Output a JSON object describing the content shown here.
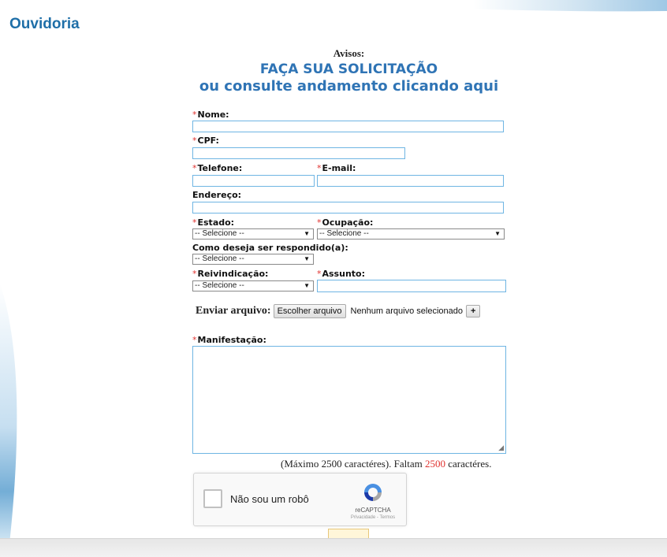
{
  "page": {
    "title": "Ouvidoria"
  },
  "notice": {
    "label": "Avisos:",
    "headline": "FAÇA SUA SOLICITAÇÃO",
    "subheadline": "ou consulte andamento clicando aqui"
  },
  "form": {
    "required_mark": "*",
    "nome": {
      "label": "Nome:",
      "value": ""
    },
    "cpf": {
      "label": "CPF:",
      "value": ""
    },
    "telefone": {
      "label": "Telefone:",
      "value": ""
    },
    "email": {
      "label": "E-mail:",
      "value": ""
    },
    "endereco": {
      "label": "Endereço:",
      "value": ""
    },
    "estado": {
      "label": "Estado:",
      "selected": "-- Selecione --"
    },
    "ocupacao": {
      "label": "Ocupação:",
      "selected": "-- Selecione --"
    },
    "resposta": {
      "label": "Como deseja ser respondido(a):",
      "selected": "-- Selecione --"
    },
    "reivindicacao": {
      "label": "Reivindicação:",
      "selected": "-- Selecione --"
    },
    "assunto": {
      "label": "Assunto:",
      "value": ""
    },
    "arquivo": {
      "label": "Enviar arquivo:",
      "button": "Escolher arquivo",
      "status": "Nenhum arquivo selecionado",
      "add_button": "+"
    },
    "manifestacao": {
      "label": "Manifestação:",
      "value": ""
    },
    "counter": {
      "prefix": "(Máximo 2500 caractéres). Faltam ",
      "remaining": "2500",
      "suffix": " caractéres."
    }
  },
  "recaptcha": {
    "label": "Não sou um robô",
    "brand": "reCAPTCHA",
    "terms": "Privacidade - Termos"
  },
  "colors": {
    "accent_blue": "#2f74b5",
    "title_blue": "#1f6fa8",
    "required_red": "#e0322f",
    "input_border": "#6fb5e3"
  }
}
